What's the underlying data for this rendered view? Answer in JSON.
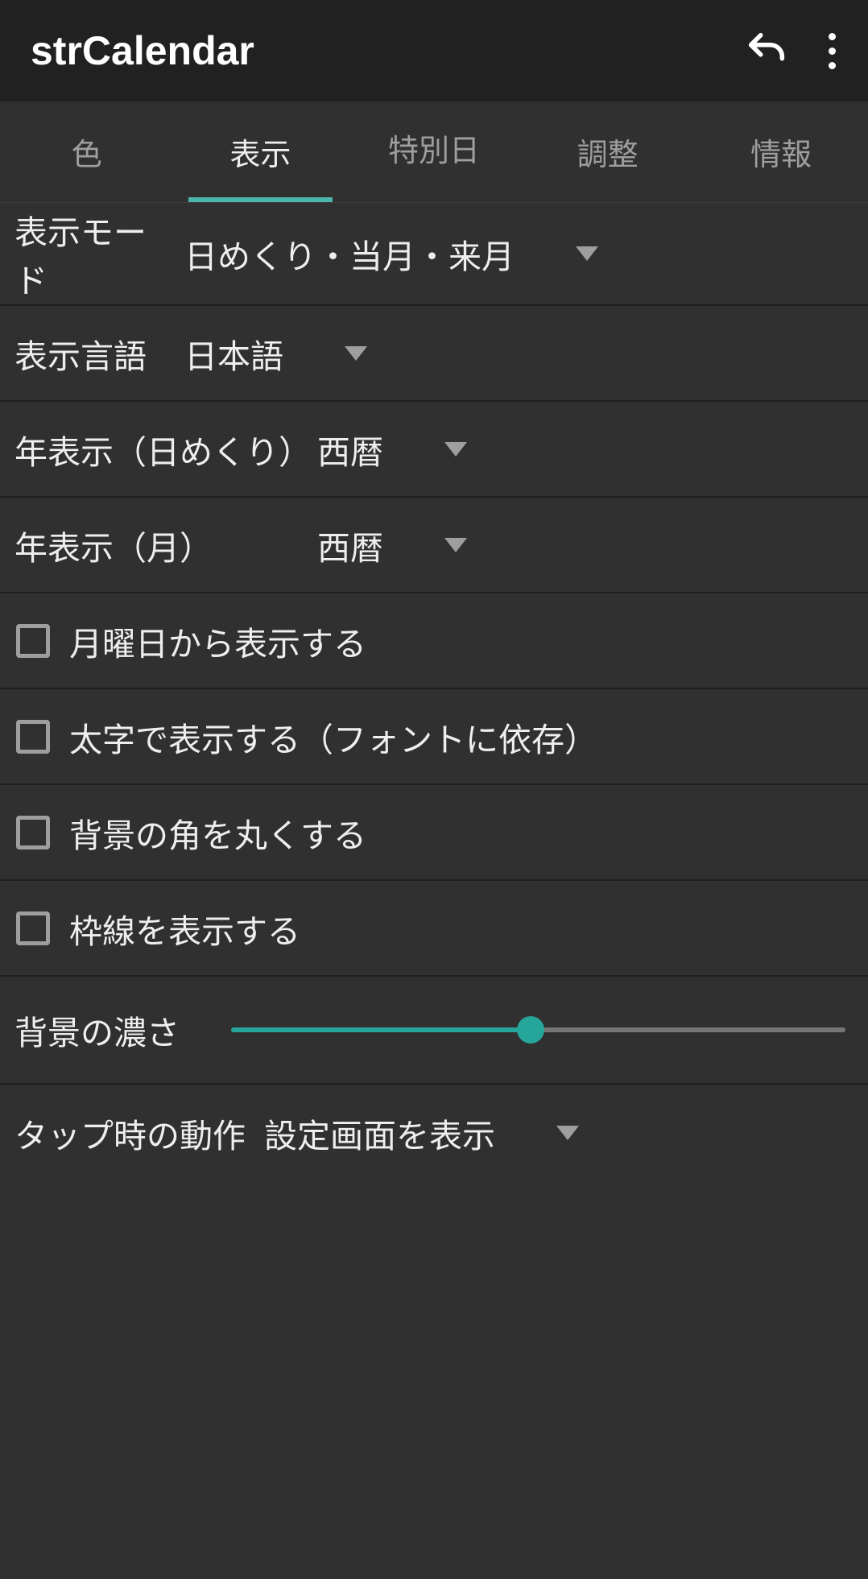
{
  "header": {
    "title": "strCalendar"
  },
  "tabs": {
    "items": [
      {
        "label": "色"
      },
      {
        "label": "表示"
      },
      {
        "label": "特別日"
      },
      {
        "label": "調整"
      },
      {
        "label": "情報"
      }
    ],
    "active_index": 1
  },
  "rows": {
    "display_mode": {
      "label": "表示モード",
      "value": "日めくり・当月・来月"
    },
    "language": {
      "label": "表示言語",
      "value": "日本語"
    },
    "year_daily": {
      "label": "年表示（日めくり）",
      "value": "西暦"
    },
    "year_month": {
      "label": "年表示（月）",
      "value": "西暦"
    },
    "checkbox1": {
      "label": "月曜日から表示する"
    },
    "checkbox2": {
      "label": "太字で表示する（フォントに依存）"
    },
    "checkbox3": {
      "label": "背景の角を丸くする"
    },
    "checkbox4": {
      "label": "枠線を表示する"
    },
    "slider": {
      "label": "背景の濃さ"
    },
    "tap_action": {
      "label": "タップ時の動作",
      "value": "設定画面を表示"
    }
  },
  "colors": {
    "accent": "#26a69a"
  }
}
